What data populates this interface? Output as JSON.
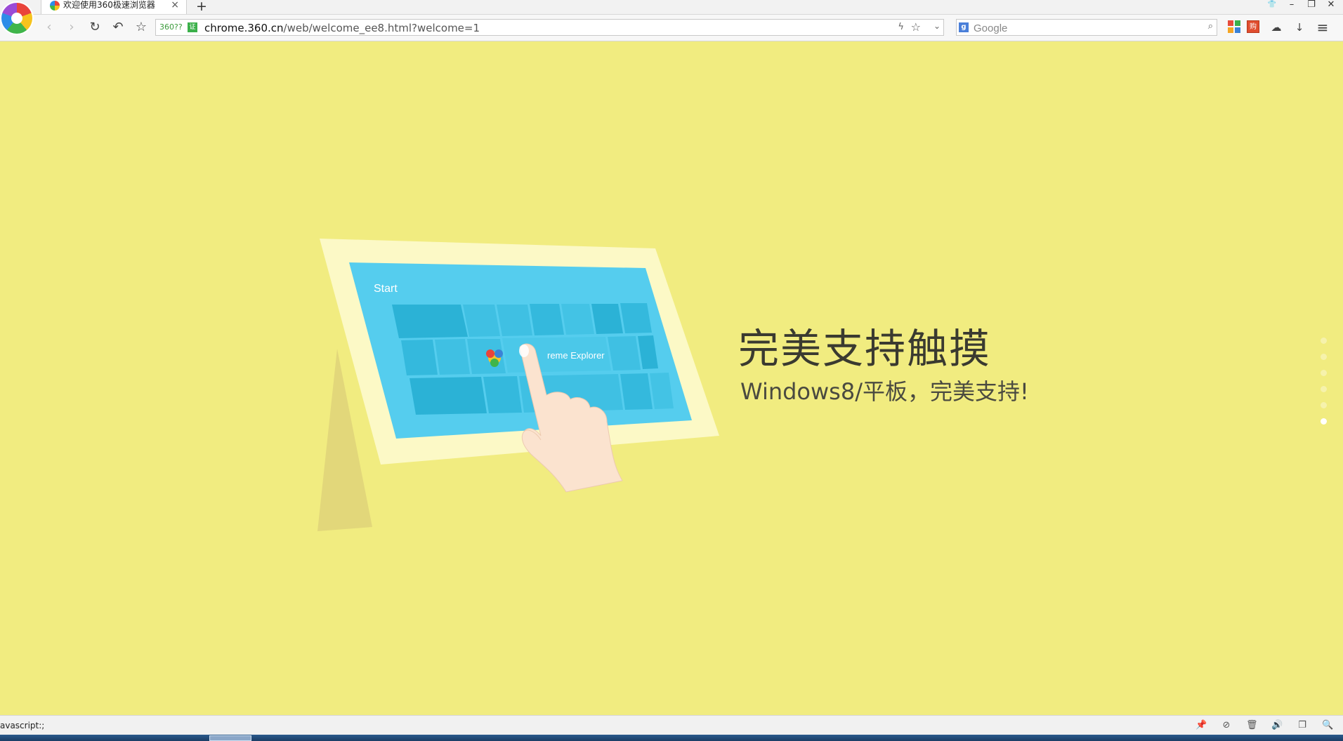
{
  "tab": {
    "title": "欢迎使用360极速浏览器",
    "close_icon": "×",
    "new_tab_icon": "+"
  },
  "window_controls": {
    "skin": "👕",
    "minimize": "–",
    "maximize": "❐",
    "close": "✕"
  },
  "nav": {
    "back": "‹",
    "forward": "›",
    "reload": "↻",
    "undo": "↶",
    "bookmark": "☆"
  },
  "address": {
    "badge": "360??",
    "cert": "证",
    "host": "chrome.360.cn",
    "path": "/web/welcome_ee8.html?welcome=1",
    "bolt": "ϟ",
    "star": "☆",
    "dropdown": "⌄"
  },
  "search": {
    "engine": "g",
    "placeholder": "Google",
    "go": "⌕"
  },
  "toolbar": {
    "shop": "购",
    "cloud": "☁",
    "download": "↓",
    "menu": "≡"
  },
  "hero": {
    "title": "完美支持触摸",
    "subtitle": "Windows8/平板，完美支持!",
    "illustration_start": "Start",
    "illustration_tile": "reme Explorer"
  },
  "pager": {
    "count": 6,
    "active_index": 5
  },
  "status": {
    "text": "avascript:;",
    "icons": [
      "📌",
      "⊘",
      "🗑",
      "🔊",
      "❐",
      "🔍"
    ]
  },
  "colors": {
    "background": "#f1ec80",
    "tablet_frame": "#fcf9c6",
    "screen": "#55cdee",
    "tile": "#2bb2d6"
  }
}
